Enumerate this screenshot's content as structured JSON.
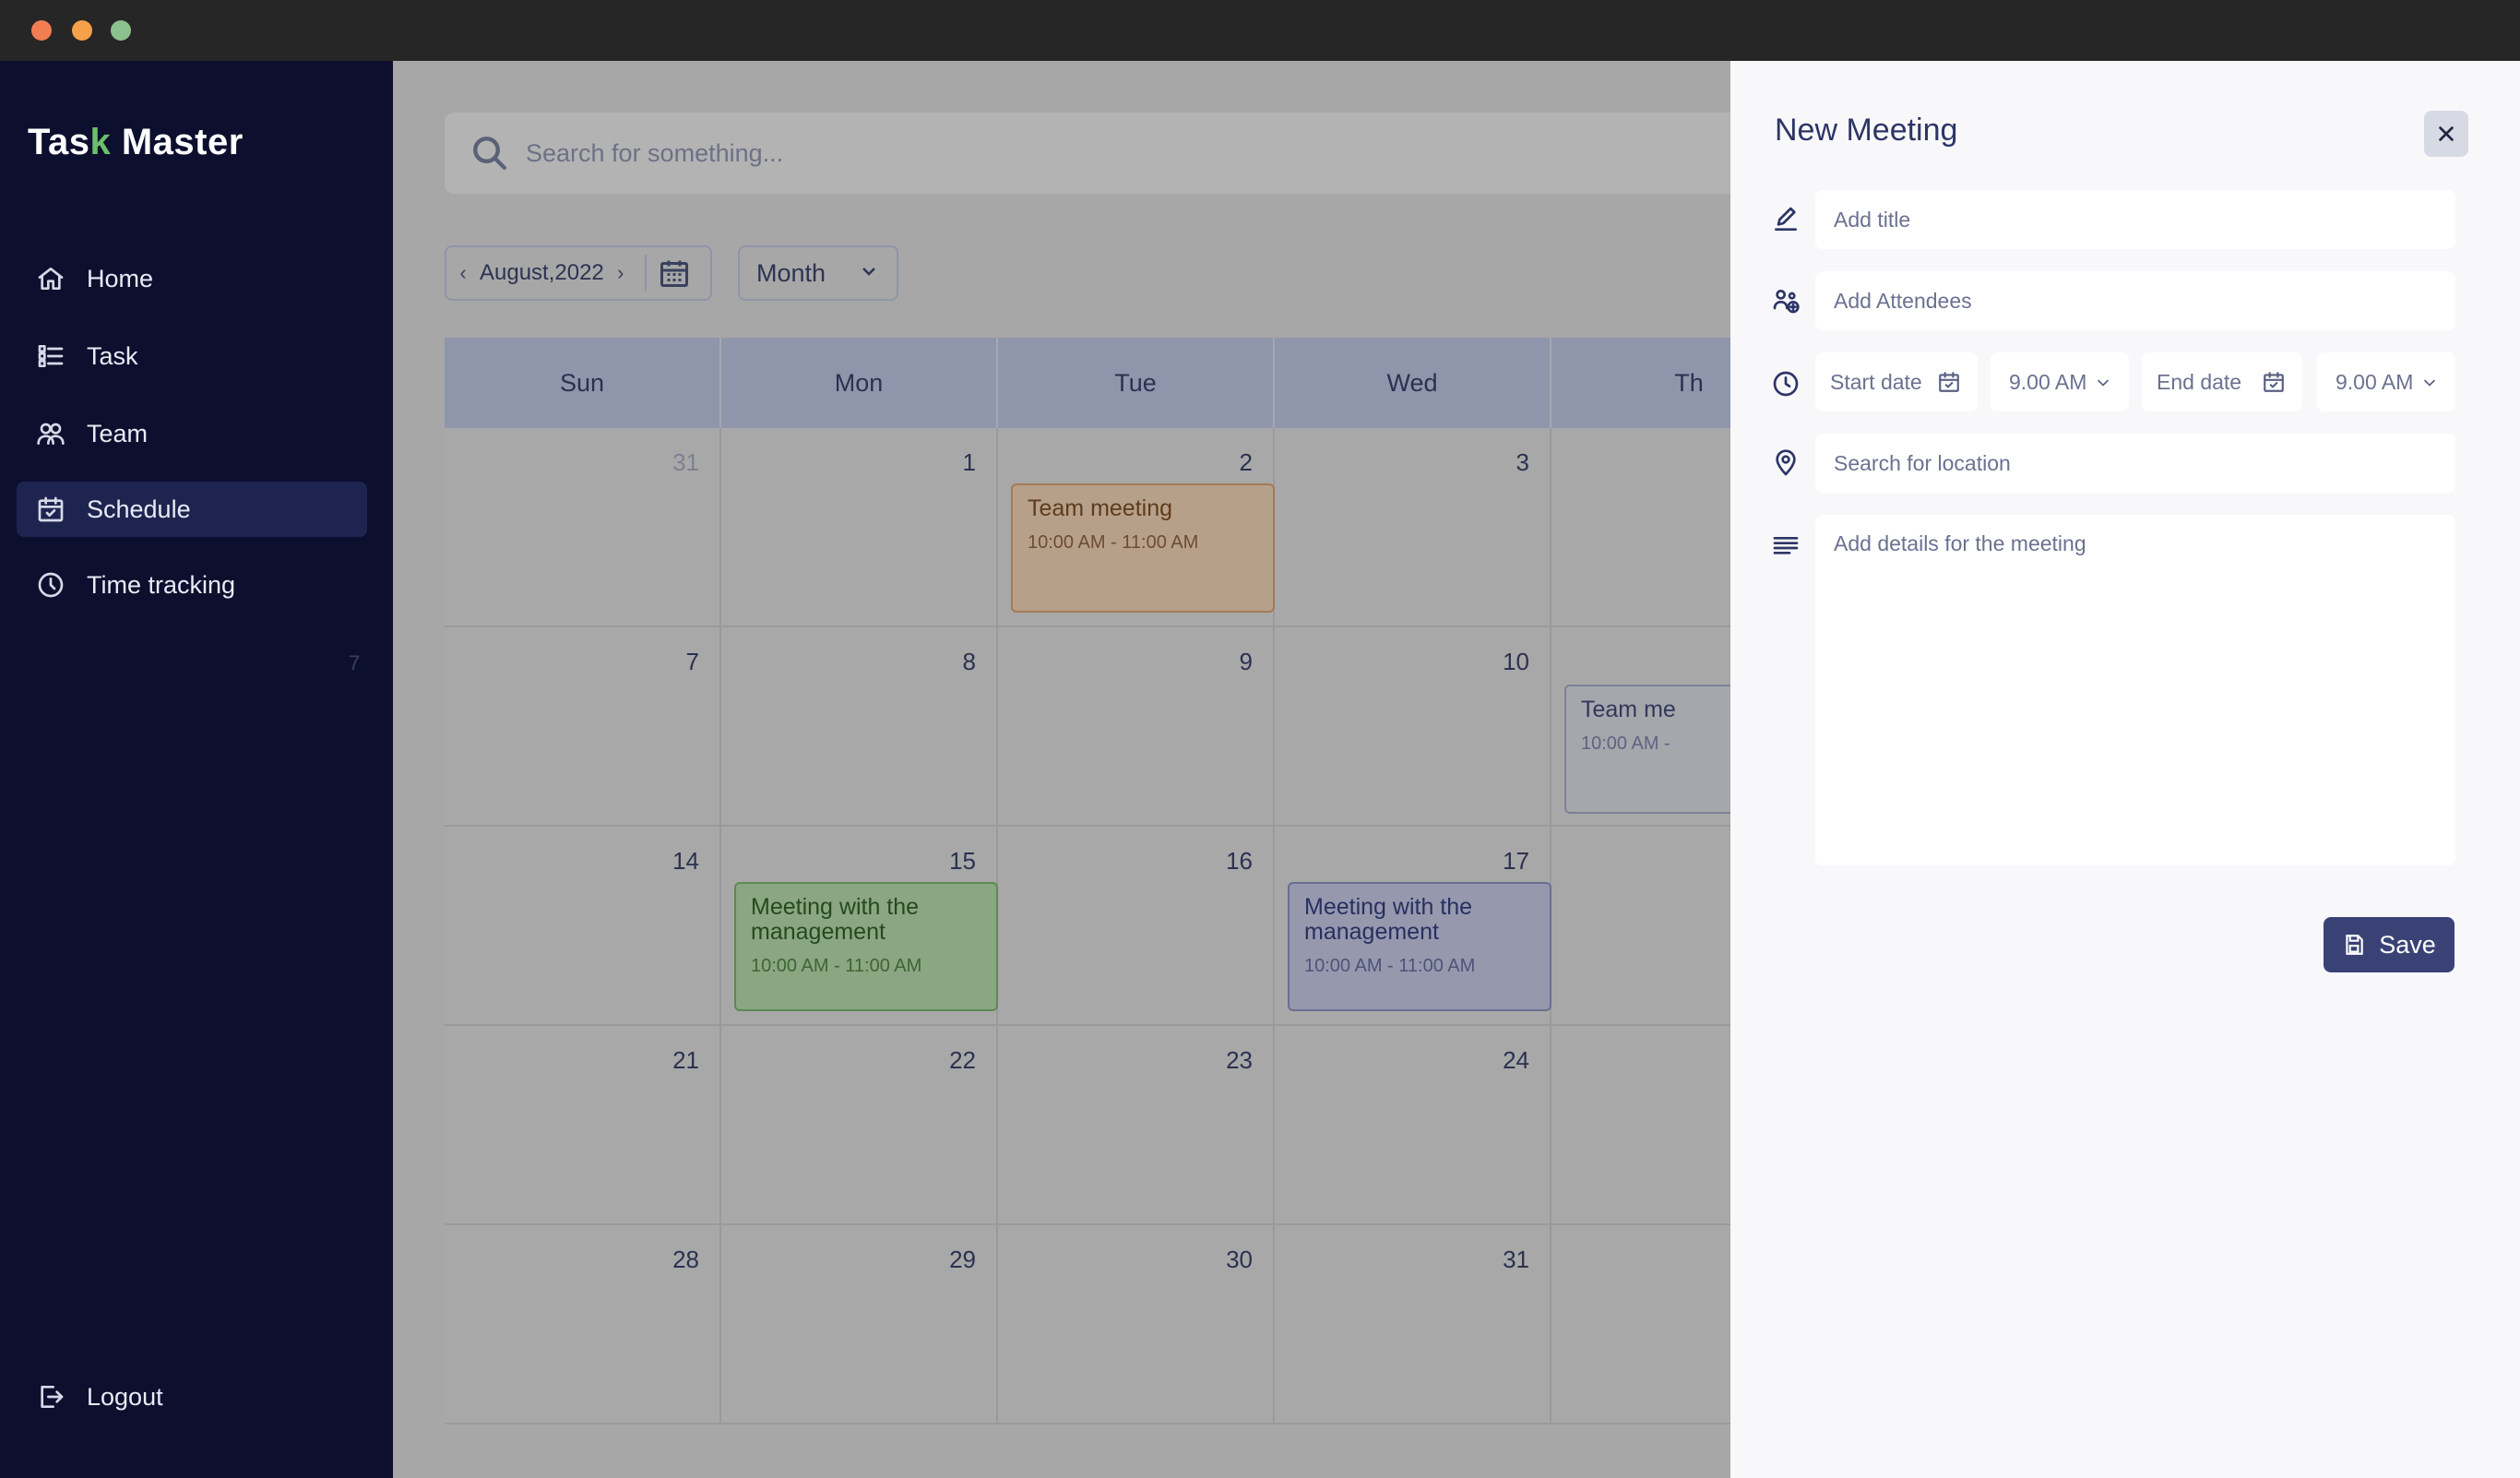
{
  "app": {
    "brand_prefix": "Tas",
    "brand_check": "k",
    "brand_suffix": " Master"
  },
  "sidebar": {
    "items": [
      {
        "label": "Home",
        "icon": "home-icon"
      },
      {
        "label": "Task",
        "icon": "task-list-icon"
      },
      {
        "label": "Team",
        "icon": "team-icon"
      },
      {
        "label": "Schedule",
        "icon": "calendar-icon",
        "active": true
      },
      {
        "label": "Time tracking",
        "icon": "clock-icon"
      }
    ],
    "side_number": "7",
    "logout": "Logout"
  },
  "search": {
    "placeholder": "Search for something..."
  },
  "calendar": {
    "month_label": "August,2022",
    "view": "Month",
    "weekdays": [
      "Sun",
      "Mon",
      "Tue",
      "Wed",
      "Th"
    ],
    "weeks": [
      [
        "31",
        "1",
        "2",
        "3",
        ""
      ],
      [
        "7",
        "8",
        "9",
        "10",
        ""
      ],
      [
        "14",
        "15",
        "16",
        "17",
        ""
      ],
      [
        "21",
        "22",
        "23",
        "24",
        ""
      ],
      [
        "28",
        "29",
        "30",
        "31",
        ""
      ]
    ],
    "events": {
      "team_meeting_1": {
        "title": "Team meeting",
        "time": "10:00 AM - 11:00 AM"
      },
      "team_meeting_2": {
        "title": "Team me",
        "time": "10:00 AM -"
      },
      "mgmt_mon": {
        "title": "Meeting with the management",
        "time": "10:00 AM - 11:00 AM"
      },
      "mgmt_wed": {
        "title": "Meeting with the management",
        "time": "10:00 AM - 11:00 AM"
      }
    },
    "event_colors": {
      "orange": "#a57a55",
      "green": "#5c8a54",
      "blue": "#6a6f90"
    }
  },
  "new_meeting": {
    "title": "New Meeting",
    "title_placeholder": "Add title",
    "attendees_placeholder": "Add Attendees",
    "start_date": "Start date",
    "start_time": "9.00 AM",
    "end_date": "End date",
    "end_time": "9.00 AM",
    "location_placeholder": "Search for location",
    "details_placeholder": "Add details for the meeting",
    "save_label": "Save",
    "accent": "#3a4275"
  }
}
